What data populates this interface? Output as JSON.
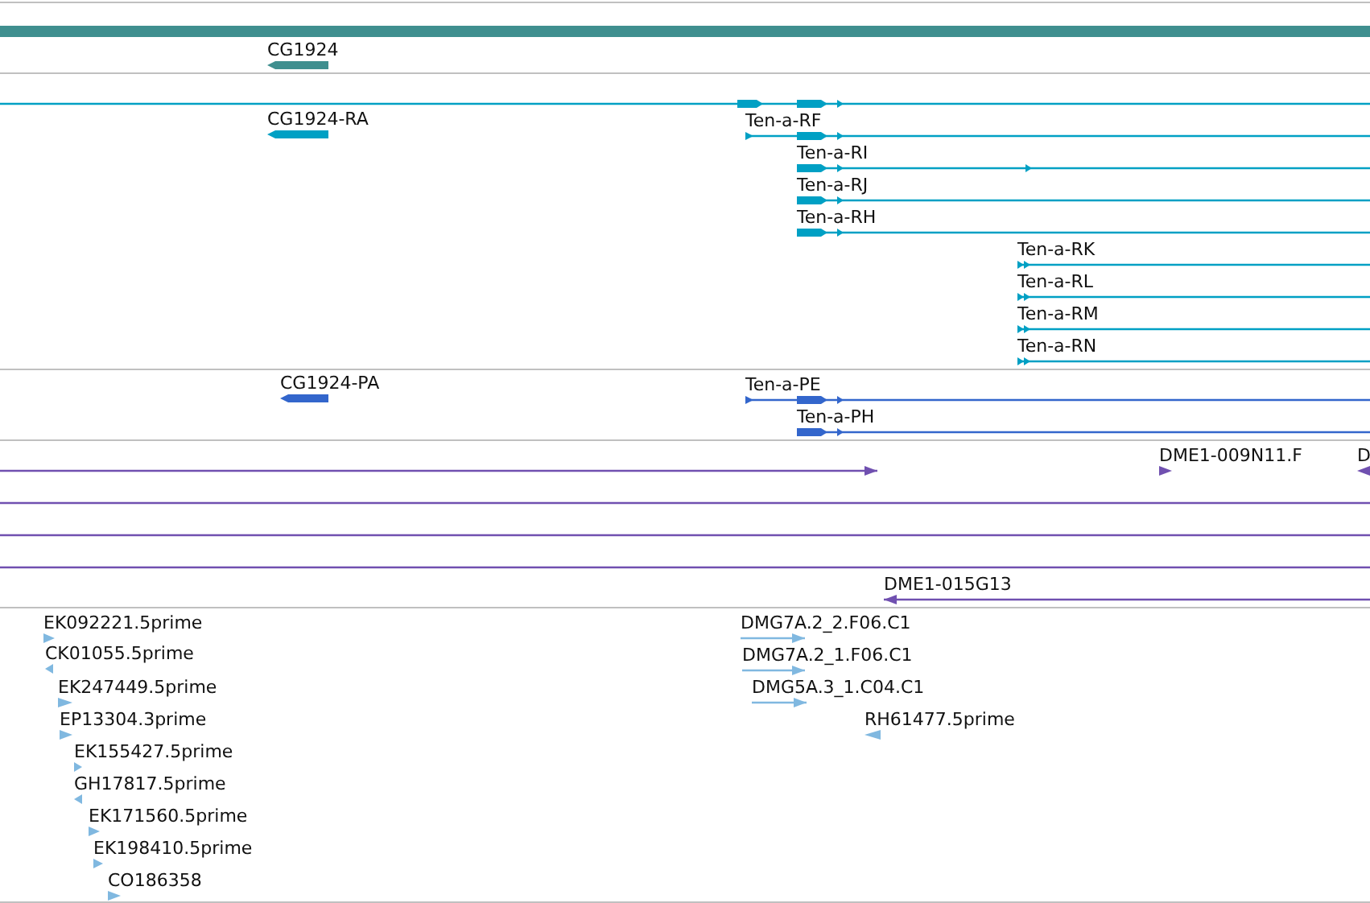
{
  "tracks": [
    {
      "color": "#3f8f8f",
      "features": [
        {
          "kind": "bar"
        },
        {
          "kind": "block",
          "label": "CG1924",
          "reverse": true
        }
      ]
    },
    {
      "color": "#00a0c4",
      "features": [
        {
          "kind": "transcript",
          "reverse": false
        },
        {
          "kind": "block",
          "label": "CG1924-RA",
          "reverse": true
        },
        {
          "kind": "transcript",
          "label": "Ten-a-RF",
          "reverse": false
        },
        {
          "kind": "transcript",
          "label": "Ten-a-RI",
          "reverse": false
        },
        {
          "kind": "transcript",
          "label": "Ten-a-RJ",
          "reverse": false
        },
        {
          "kind": "transcript",
          "label": "Ten-a-RH",
          "reverse": false
        },
        {
          "kind": "transcript",
          "label": "Ten-a-RK",
          "reverse": false
        },
        {
          "kind": "transcript",
          "label": "Ten-a-RL",
          "reverse": false
        },
        {
          "kind": "transcript",
          "label": "Ten-a-RM",
          "reverse": false
        },
        {
          "kind": "transcript",
          "label": "Ten-a-RN",
          "reverse": false
        }
      ]
    },
    {
      "color": "#3366cc",
      "features": [
        {
          "kind": "block",
          "label": "CG1924-PA",
          "reverse": true
        },
        {
          "kind": "transcript",
          "label": "Ten-a-PE",
          "reverse": false
        },
        {
          "kind": "transcript",
          "label": "Ten-a-PH",
          "reverse": false
        }
      ]
    },
    {
      "color": "#7050b0",
      "features": [
        {
          "kind": "span",
          "reverse": false
        },
        {
          "kind": "arrow",
          "label": "DME1-009N11.F",
          "reverse": false
        },
        {
          "kind": "arrow",
          "label": "D",
          "reverse": true
        },
        {
          "kind": "line"
        },
        {
          "kind": "line"
        },
        {
          "kind": "line"
        },
        {
          "kind": "span",
          "label": "DME1-015G13",
          "reverse": true
        }
      ]
    },
    {
      "color": "#80b8e0",
      "features": [
        {
          "kind": "arrow",
          "label": "EK092221.5prime",
          "reverse": false
        },
        {
          "kind": "span",
          "label": "DMG7A.2_2.F06.C1",
          "reverse": false
        },
        {
          "kind": "arrow",
          "label": "CK01055.5prime",
          "reverse": true
        },
        {
          "kind": "span",
          "label": "DMG7A.2_1.F06.C1",
          "reverse": false
        },
        {
          "kind": "arrow",
          "label": "EK247449.5prime",
          "reverse": false
        },
        {
          "kind": "span",
          "label": "DMG5A.3_1.C04.C1",
          "reverse": false
        },
        {
          "kind": "arrow",
          "label": "EP13304.3prime",
          "reverse": false
        },
        {
          "kind": "arrow",
          "label": "RH61477.5prime",
          "reverse": true
        },
        {
          "kind": "arrow",
          "label": "EK155427.5prime",
          "reverse": false
        },
        {
          "kind": "arrow",
          "label": "GH17817.5prime",
          "reverse": true
        },
        {
          "kind": "arrow",
          "label": "EK171560.5prime",
          "reverse": false
        },
        {
          "kind": "arrow",
          "label": "EK198410.5prime",
          "reverse": false
        },
        {
          "kind": "arrow",
          "label": "CO186358",
          "reverse": false
        }
      ]
    }
  ]
}
